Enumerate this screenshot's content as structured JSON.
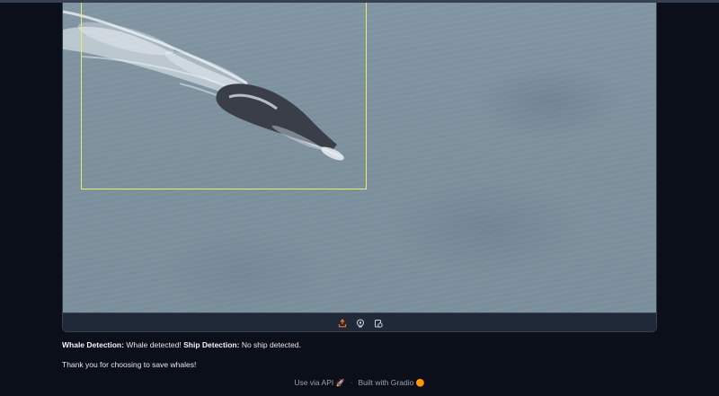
{
  "result": {
    "whale_label": "Whale Detection:",
    "whale_value": " Whale detected! ",
    "ship_label": "Ship Detection:",
    "ship_value": " No ship detected."
  },
  "thanks": "Thank you for choosing to save whales!",
  "toolbar": {
    "buttons": [
      "download-icon",
      "share-icon",
      "clear-icon"
    ]
  },
  "footer": {
    "api_label": "Use via API",
    "api_icon": "🚀",
    "separator": "·",
    "built_label": "Built with Gradio",
    "built_icon": "🟠"
  },
  "colors": {
    "background": "#0b0f19",
    "bbox": "#e7ef6a",
    "accent": "#f97316"
  }
}
